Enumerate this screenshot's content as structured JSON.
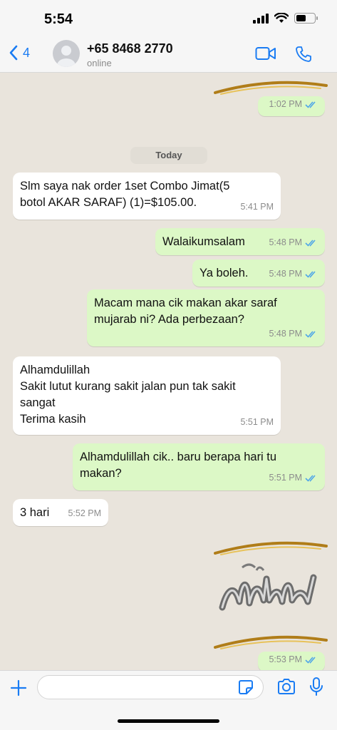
{
  "status_bar": {
    "time": "5:54",
    "battery_level": 0.55
  },
  "header": {
    "back_count": "4",
    "contact_name": "+65 8468 2770",
    "contact_status": "online"
  },
  "chat": {
    "date_label": "Today",
    "messages": [
      {
        "dir": "out",
        "text": "",
        "time": "1:02 PM",
        "kind": "sticker-tail"
      },
      {
        "dir": "in",
        "text": "Slm saya nak order 1set Combo Jimat(5\nbotol AKAR SARAF) (1)=$105.00.",
        "time": "5:41 PM"
      },
      {
        "dir": "out",
        "text": "Walaikumsalam",
        "time": "5:48 PM"
      },
      {
        "dir": "out",
        "text": "Ya boleh.",
        "time": "5:48 PM"
      },
      {
        "dir": "out",
        "text": "Macam mana cik makan akar saraf\nmujarab ni? Ada perbezaan?",
        "time": "5:48 PM"
      },
      {
        "dir": "in",
        "text": "Alhamdulillah\nSakit lutut kurang sakit jalan pun tak sakit\nsangat\nTerima kasih",
        "time": "5:51 PM"
      },
      {
        "dir": "out",
        "text": "Alhamdulillah cik.. baru berapa hari tu\nmakan?",
        "time": "5:51 PM"
      },
      {
        "dir": "in",
        "text": "3 hari",
        "time": "5:52 PM"
      },
      {
        "dir": "out",
        "text": "",
        "time": "5:53 PM",
        "kind": "sticker"
      }
    ]
  },
  "composer": {
    "placeholder": ""
  },
  "colors": {
    "accent": "#1a7cf3",
    "outgoing_bubble": "#dcf8c6",
    "incoming_bubble": "#ffffff",
    "read_ticks": "#4fa6e8",
    "wallpaper": "#e9e4dc"
  }
}
